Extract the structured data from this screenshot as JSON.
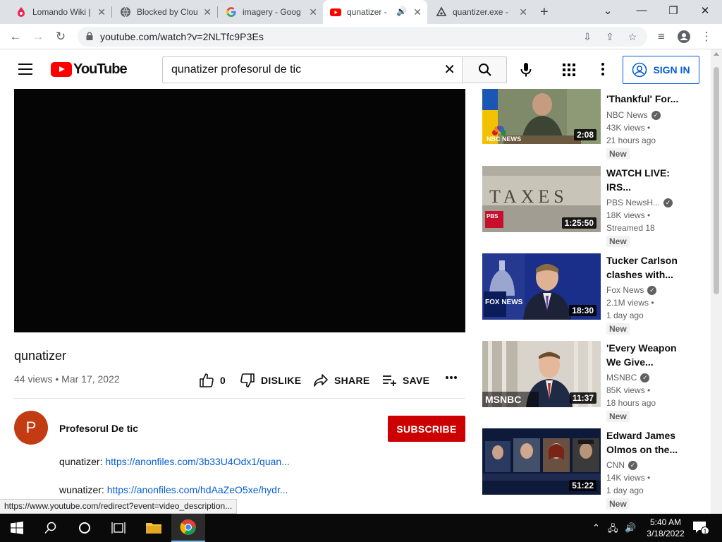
{
  "browser": {
    "tabs": [
      {
        "title": "Lomando Wiki |",
        "favicon": "lomando-icon",
        "active": false
      },
      {
        "title": "Blocked by Clou",
        "favicon": "globe-icon",
        "active": false
      },
      {
        "title": "imagery - Goog",
        "favicon": "google-icon",
        "active": false
      },
      {
        "title": "qunatizer -",
        "favicon": "youtube-icon",
        "active": true,
        "audio": true
      },
      {
        "title": "quantizer.exe -",
        "favicon": "anonfiles-icon",
        "active": false
      }
    ],
    "url": "youtube.com/watch?v=2NLTfc9P3Es",
    "status_url": "https://www.youtube.com/redirect?event=video_description..."
  },
  "masthead": {
    "logo_text": "YouTube",
    "search_query": "qunatizer profesorul de tic",
    "signin_label": "SIGN IN"
  },
  "video": {
    "title": "qunatizer",
    "views": "44 views",
    "date": "Mar 17, 2022",
    "likes": "0",
    "dislike_label": "DISLIKE",
    "share_label": "SHARE",
    "save_label": "SAVE"
  },
  "channel": {
    "avatar_letter": "P",
    "name": "Profesorul De tic",
    "subscribe_label": "SUBSCRIBE"
  },
  "description": [
    {
      "prefix": "qunatizer: ",
      "link": "https://anonfiles.com/3b33U4Odx1/quan..."
    },
    {
      "prefix": "wunatizer: ",
      "link": "https://anonfiles.com/hdAaZeO5xe/hydr..."
    }
  ],
  "recommendations": [
    {
      "title": "'Thankful' For...",
      "channel": "NBC News",
      "views": "43K views •",
      "time": "21 hours ago",
      "badge": "New",
      "duration": "2:08"
    },
    {
      "title": "WATCH LIVE: IRS...",
      "channel": "PBS NewsH...",
      "views": "18K views •",
      "time": "Streamed 18",
      "badge": "New",
      "duration": "1:25:50"
    },
    {
      "title": "Tucker Carlson clashes with...",
      "channel": "Fox News",
      "views": "2.1M views •",
      "time": "1 day ago",
      "badge": "New",
      "duration": "18:30"
    },
    {
      "title": "'Every Weapon We Give...",
      "channel": "MSNBC",
      "views": "85K views •",
      "time": "18 hours ago",
      "badge": "New",
      "duration": "11:37"
    },
    {
      "title": "Edward James Olmos on the...",
      "channel": "CNN",
      "views": "14K views •",
      "time": "1 day ago",
      "badge": "New",
      "duration": "51:22"
    }
  ],
  "thumb_text": {
    "nbc": "NBC NEWS",
    "taxes": "TAXES",
    "pbs": "PBS",
    "fox": "FOX NEWS",
    "msnbc": "MSNBC"
  },
  "taskbar": {
    "time": "5:40 AM",
    "date": "3/18/2022",
    "notification_count": "1"
  },
  "colors": {
    "youtube_red": "#ff0000",
    "subscribe_red": "#cc0000",
    "link_blue": "#065fd4",
    "avatar": "#c23b12"
  }
}
